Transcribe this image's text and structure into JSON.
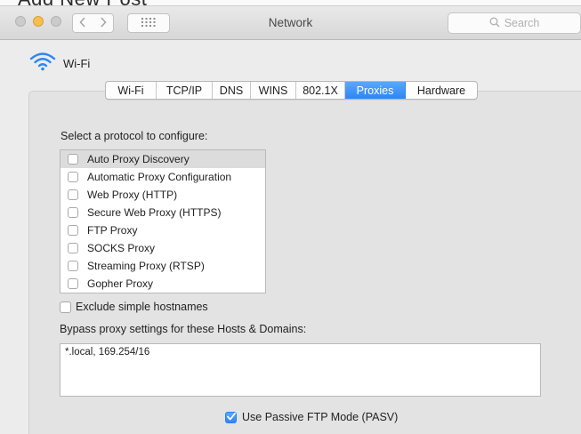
{
  "window": {
    "title": "Network",
    "search_placeholder": "Search"
  },
  "behind_window_text": "Add New Post",
  "interface": {
    "name": "Wi-Fi",
    "icon": "wifi-icon"
  },
  "tabs": [
    {
      "label": "Wi-Fi",
      "active": false
    },
    {
      "label": "TCP/IP",
      "active": false
    },
    {
      "label": "DNS",
      "active": false
    },
    {
      "label": "WINS",
      "active": false
    },
    {
      "label": "802.1X",
      "active": false
    },
    {
      "label": "Proxies",
      "active": true
    },
    {
      "label": "Hardware",
      "active": false
    }
  ],
  "proxies": {
    "protocol_label": "Select a protocol to configure:",
    "protocols": [
      {
        "label": "Auto Proxy Discovery",
        "checked": false,
        "selected": true
      },
      {
        "label": "Automatic Proxy Configuration",
        "checked": false,
        "selected": false
      },
      {
        "label": "Web Proxy (HTTP)",
        "checked": false,
        "selected": false
      },
      {
        "label": "Secure Web Proxy (HTTPS)",
        "checked": false,
        "selected": false
      },
      {
        "label": "FTP Proxy",
        "checked": false,
        "selected": false
      },
      {
        "label": "SOCKS Proxy",
        "checked": false,
        "selected": false
      },
      {
        "label": "Streaming Proxy (RTSP)",
        "checked": false,
        "selected": false
      },
      {
        "label": "Gopher Proxy",
        "checked": false,
        "selected": false
      }
    ],
    "exclude_simple_hostnames": {
      "label": "Exclude simple hostnames",
      "checked": false
    },
    "bypass_label": "Bypass proxy settings for these Hosts & Domains:",
    "bypass_value": "*.local, 169.254/16",
    "passive_ftp": {
      "label": "Use Passive FTP Mode (PASV)",
      "checked": true
    }
  },
  "colors": {
    "accent": "#2c86f5",
    "minimize_light": "#f5be4f"
  }
}
